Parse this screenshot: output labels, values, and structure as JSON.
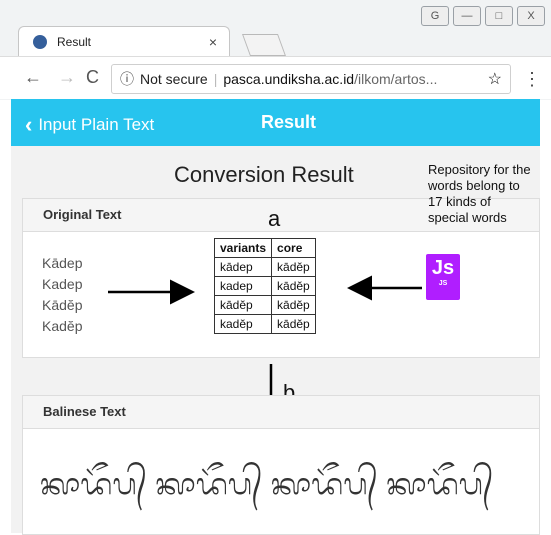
{
  "browser": {
    "tab_title": "Result",
    "tab_close": "×",
    "not_secure": "Not secure",
    "url_host": "pasca.undiksha.ac.id",
    "url_path": "/ilkom/artos...",
    "star_icon": "star-icon",
    "menu": "⋮",
    "win_buttons": [
      "G",
      "—",
      "□",
      "X"
    ]
  },
  "app_header": {
    "back_label": "Input Plain Text",
    "title": "Result"
  },
  "page": {
    "conversion_title": "Conversion Result",
    "repository_note": "Repository for the words belong to 17 kinds of special words",
    "label_a": "a",
    "label_b": "b",
    "original_panel_title": "Original Text",
    "original_words": [
      "Kādep",
      "Kadep",
      "Kādĕp",
      "Kadĕp"
    ],
    "table": {
      "headers": [
        "variants",
        "core"
      ],
      "rows": [
        [
          "kādep",
          "kādĕp"
        ],
        [
          "kadep",
          "kādĕp"
        ],
        [
          "kādĕp",
          "kādĕp"
        ],
        [
          "kadĕp",
          "kādĕp"
        ]
      ]
    },
    "js_badge": {
      "big": "Js",
      "small": "JS"
    },
    "balinese_panel_title": "Balinese Text",
    "balinese_text": "ᬓᬵᬤᭂᬧ᭄ ᬓᬵᬤᭂᬧ᭄ ᬓᬵᬤᭂᬧ᭄ ᬓᬵᬤᭂᬧ᭄"
  }
}
